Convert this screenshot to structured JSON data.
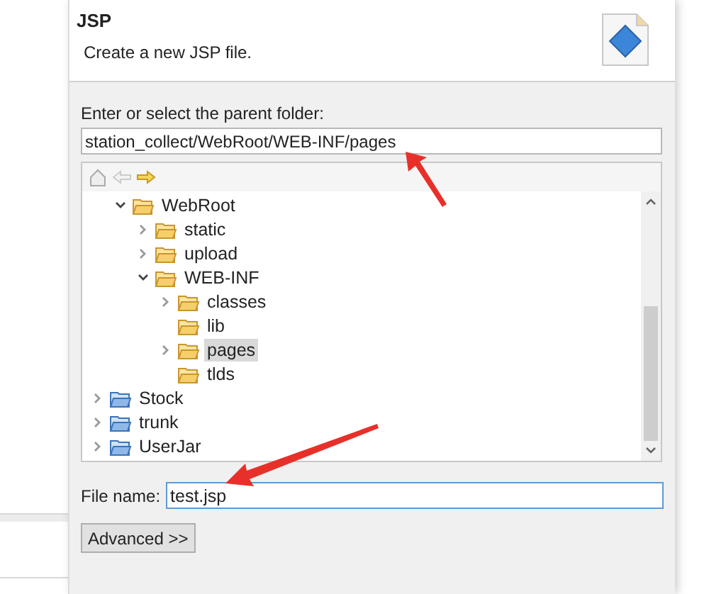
{
  "header": {
    "title": "JSP",
    "subtitle": "Create a new JSP file."
  },
  "folder": {
    "label": "Enter or select the parent folder:",
    "value": "station_collect/WebRoot/WEB-INF/pages"
  },
  "tree": {
    "items": [
      {
        "children": [
          {
            "label": "WebRoot",
            "kind": "folder",
            "expanded": true,
            "selected": false,
            "children": [
              {
                "label": "static",
                "kind": "folder",
                "expanded": false,
                "selected": false
              },
              {
                "label": "upload",
                "kind": "folder",
                "expanded": false,
                "selected": false
              },
              {
                "label": "WEB-INF",
                "kind": "folder",
                "expanded": true,
                "selected": false,
                "children": [
                  {
                    "label": "classes",
                    "kind": "folder",
                    "expanded": false,
                    "selected": false
                  },
                  {
                    "label": "lib",
                    "kind": "folder",
                    "selected": false
                  },
                  {
                    "label": "pages",
                    "kind": "folder",
                    "expanded": false,
                    "selected": true
                  },
                  {
                    "label": "tlds",
                    "kind": "folder",
                    "selected": false
                  }
                ]
              }
            ]
          }
        ]
      },
      {
        "label": "Stock",
        "kind": "project",
        "expanded": false,
        "selected": false
      },
      {
        "label": "trunk",
        "kind": "project",
        "expanded": false,
        "selected": false
      },
      {
        "label": "UserJar",
        "kind": "project",
        "expanded": false,
        "selected": false
      }
    ]
  },
  "file_name": {
    "label": "File name:",
    "value": "test.jsp"
  },
  "advanced_button": "Advanced >>"
}
